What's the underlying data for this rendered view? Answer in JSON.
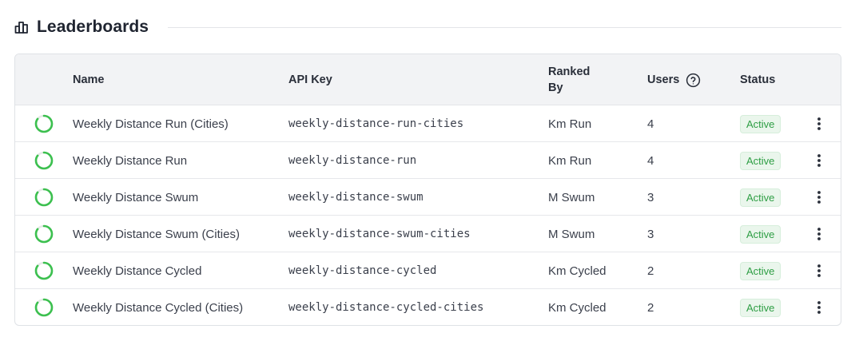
{
  "header": {
    "title": "Leaderboards",
    "icon": "bar-chart-icon"
  },
  "columns": {
    "name": "Name",
    "api_key": "API Key",
    "ranked_by": "Ranked By",
    "users": "Users",
    "users_help_icon": "help-circle-icon",
    "status": "Status"
  },
  "colors": {
    "progress_ring": "#3cc04f",
    "badge_text": "#2e9e44",
    "badge_bg": "#eaf6ec"
  },
  "rows": [
    {
      "name": "Weekly Distance Run (Cities)",
      "api_key": "weekly-distance-run-cities",
      "ranked_by": "Km Run",
      "users": "4",
      "status": "Active",
      "progress": 0.85
    },
    {
      "name": "Weekly Distance Run",
      "api_key": "weekly-distance-run",
      "ranked_by": "Km Run",
      "users": "4",
      "status": "Active",
      "progress": 0.85
    },
    {
      "name": "Weekly Distance Swum",
      "api_key": "weekly-distance-swum",
      "ranked_by": "M Swum",
      "users": "3",
      "status": "Active",
      "progress": 0.85
    },
    {
      "name": "Weekly Distance Swum (Cities)",
      "api_key": "weekly-distance-swum-cities",
      "ranked_by": "M Swum",
      "users": "3",
      "status": "Active",
      "progress": 0.85
    },
    {
      "name": "Weekly Distance Cycled",
      "api_key": "weekly-distance-cycled",
      "ranked_by": "Km Cycled",
      "users": "2",
      "status": "Active",
      "progress": 0.85
    },
    {
      "name": "Weekly Distance Cycled (Cities)",
      "api_key": "weekly-distance-cycled-cities",
      "ranked_by": "Km Cycled",
      "users": "2",
      "status": "Active",
      "progress": 0.85
    }
  ]
}
